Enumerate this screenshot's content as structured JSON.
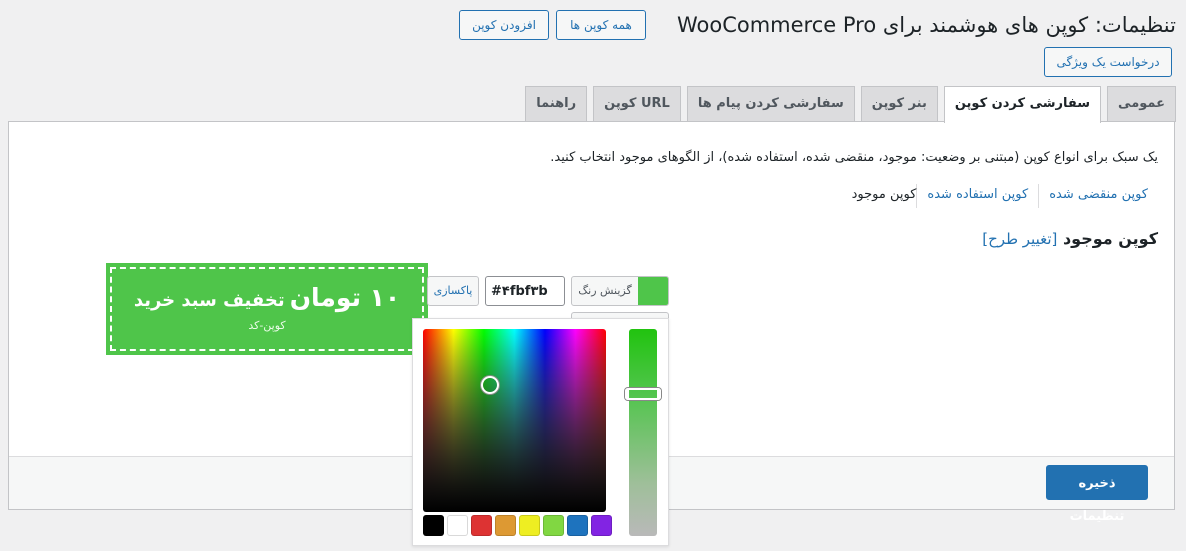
{
  "header": {
    "title": "تنظیمات: کوپن های هوشمند برای WooCommerce Pro",
    "all_coupons": "همه کوپن ها",
    "add_coupon": "افزودن کوپن",
    "feature_request": "درخواست یک ویژگی"
  },
  "tabs": [
    {
      "label": "عمومی"
    },
    {
      "label": "سفارشی کردن کوپن"
    },
    {
      "label": "بنر کوپن"
    },
    {
      "label": "سفارشی کردن پیام ها"
    },
    {
      "label": "کوپن URL"
    },
    {
      "label": "راهنما"
    }
  ],
  "active_tab": "سفارشی کردن کوپن",
  "description": "یک سبک برای انواع کوپن (مبتنی بر وضعیت: موجود، منقضی شده، استفاده شده)، از الگوهای موجود انتخاب کنید.",
  "subnav": [
    {
      "label": "کوپن موجود"
    },
    {
      "label": "کوپن استفاده شده"
    },
    {
      "label": "کوپن منقضی شده"
    }
  ],
  "section": {
    "title": "کوپن موجود",
    "change_link": "[تغییر طرح]"
  },
  "coupon_preview": {
    "amount": "۱۰ تومان",
    "text": "تخفیف سبد خرید",
    "code": "کوپن-کد",
    "color": "#4fc54a"
  },
  "color_control": {
    "pick_label": "گزینش رنگ",
    "hex_value": "#۴fbf۳b",
    "clear_label": "پاکسازی"
  },
  "palette": [
    "#000000",
    "#ffffff",
    "#dd3333",
    "#dd9933",
    "#eeee22",
    "#81d742",
    "#1e73be",
    "#8224e3"
  ],
  "footer": {
    "save_label": "ذخیره تنظیمات"
  }
}
